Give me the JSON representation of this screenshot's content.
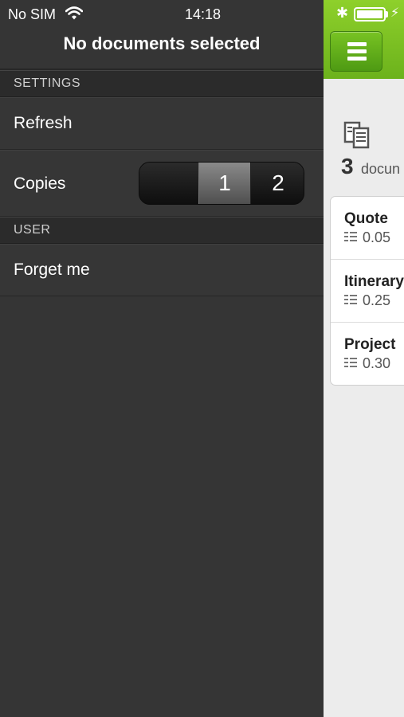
{
  "status": {
    "carrier": "No SIM",
    "time": "14:18"
  },
  "drawer": {
    "title": "No documents selected",
    "settings_header": "SETTINGS",
    "refresh_label": "Refresh",
    "copies_label": "Copies",
    "copies_options": [
      "1",
      "2"
    ],
    "copies_selected": "1",
    "user_header": "USER",
    "forget_label": "Forget me"
  },
  "main": {
    "doc_count": "3",
    "doc_count_label": "docun",
    "documents": [
      {
        "name": "Quote",
        "value": "0.05"
      },
      {
        "name": "Itinerary",
        "value": "0.25"
      },
      {
        "name": "Project",
        "value": "0.30"
      }
    ]
  },
  "colors": {
    "accent": "#6cb21c",
    "drawer_bg": "#353535",
    "main_bg": "#ececec"
  },
  "icons": [
    "wifi-icon",
    "bluetooth-icon",
    "battery-icon",
    "charging-icon",
    "menu-icon",
    "documents-icon",
    "document-list-icon"
  ]
}
